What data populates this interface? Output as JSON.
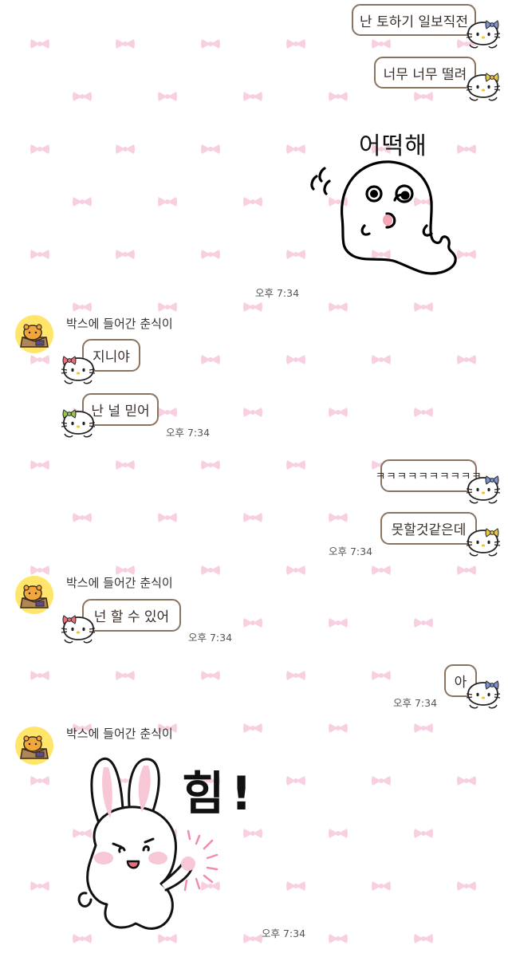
{
  "colors": {
    "background": "#ffffff",
    "bubble_border": "#8a7460",
    "bow_pattern": "#f7cfe0",
    "avatar_bg": "#ffe66b"
  },
  "icons": {
    "bow_pattern": "pink-bow-icon",
    "bubble_tail": "hello-kitty-icon",
    "profile": "bear-in-box-avatar-icon"
  },
  "chat": {
    "sender_name": "박스에 들어간 춘식이",
    "messages": [
      {
        "side": "me",
        "type": "text",
        "text": "난 토하기 일보직전",
        "bow": "#7d92cf"
      },
      {
        "side": "me",
        "type": "text",
        "text": "너무 너무 떨려",
        "bow": "#e8c64a"
      },
      {
        "side": "me",
        "type": "sticker",
        "sticker": "ghost-worried-sticker",
        "caption": "어떡해",
        "time": "오후 7:34"
      },
      {
        "side": "them",
        "type": "text",
        "text": "지니야",
        "bow": "#e86e7a"
      },
      {
        "side": "them",
        "type": "text",
        "text": "난 널 믿어",
        "bow": "#9cc450",
        "time": "오후 7:34"
      },
      {
        "side": "me",
        "type": "text",
        "text": "ㅋㅋㅋㅋㅋㅋㅋㅋㅋㅋ",
        "bow": "#7d92cf"
      },
      {
        "side": "me",
        "type": "text",
        "text": "못할것같은데",
        "bow": "#e8c64a",
        "time": "오후 7:34"
      },
      {
        "side": "them",
        "type": "text",
        "text": "넌 할 수 있어",
        "bow": "#e86e7a",
        "time": "오후 7:34"
      },
      {
        "side": "me",
        "type": "text",
        "text": "아",
        "bow": "#7d92cf",
        "time": "오후 7:34"
      },
      {
        "side": "them",
        "type": "sticker",
        "sticker": "bunny-cheer-sticker",
        "caption": "힘!",
        "time": "오후 7:34"
      }
    ]
  }
}
